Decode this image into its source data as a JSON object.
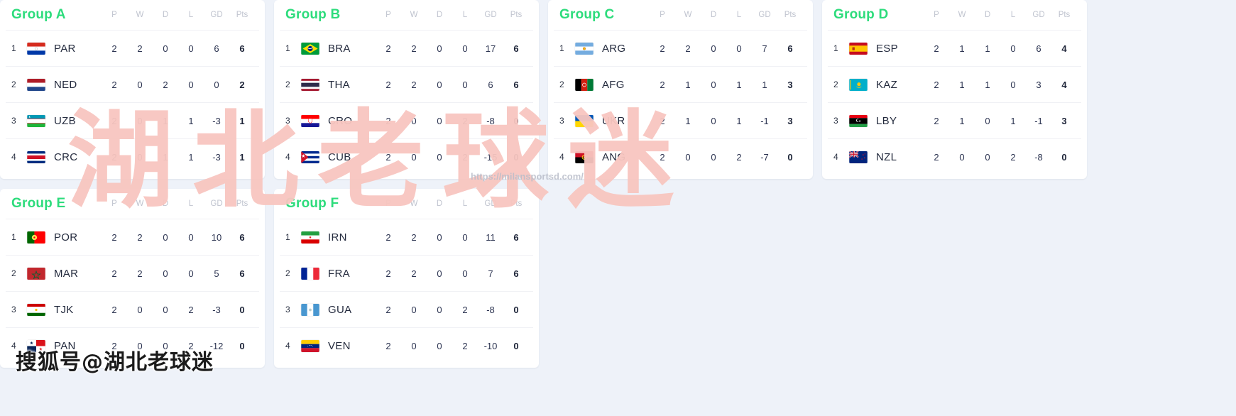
{
  "columns": [
    "P",
    "W",
    "D",
    "L",
    "GD",
    "Pts"
  ],
  "watermarks": {
    "big_text": "湖北老球迷",
    "url": "https://milansportsd.com/",
    "sohu": "搜狐号@湖北老球迷",
    "big_color": "#f8c6c0",
    "accent_color": "#2ddc7c"
  },
  "groups": [
    {
      "title": "Group A",
      "rows": [
        {
          "rank": "1",
          "team": "PAR",
          "flag": "paraguay",
          "P": "2",
          "W": "2",
          "D": "0",
          "L": "0",
          "GD": "6",
          "Pts": "6"
        },
        {
          "rank": "2",
          "team": "NED",
          "flag": "netherlands",
          "P": "2",
          "W": "0",
          "D": "2",
          "L": "0",
          "GD": "0",
          "Pts": "2"
        },
        {
          "rank": "3",
          "team": "UZB",
          "flag": "uzbekistan",
          "P": "2",
          "W": "0",
          "D": "1",
          "L": "1",
          "GD": "-3",
          "Pts": "1"
        },
        {
          "rank": "4",
          "team": "CRC",
          "flag": "costarica",
          "P": "2",
          "W": "0",
          "D": "1",
          "L": "1",
          "GD": "-3",
          "Pts": "1"
        }
      ]
    },
    {
      "title": "Group B",
      "rows": [
        {
          "rank": "1",
          "team": "BRA",
          "flag": "brazil",
          "P": "2",
          "W": "2",
          "D": "0",
          "L": "0",
          "GD": "17",
          "Pts": "6"
        },
        {
          "rank": "2",
          "team": "THA",
          "flag": "thailand",
          "P": "2",
          "W": "2",
          "D": "0",
          "L": "0",
          "GD": "6",
          "Pts": "6"
        },
        {
          "rank": "3",
          "team": "CRO",
          "flag": "croatia",
          "P": "2",
          "W": "0",
          "D": "0",
          "L": "2",
          "GD": "-8",
          "Pts": "0"
        },
        {
          "rank": "4",
          "team": "CUB",
          "flag": "cuba",
          "P": "2",
          "W": "0",
          "D": "0",
          "L": "2",
          "GD": "-15",
          "Pts": "0"
        }
      ]
    },
    {
      "title": "Group C",
      "rows": [
        {
          "rank": "1",
          "team": "ARG",
          "flag": "argentina",
          "P": "2",
          "W": "2",
          "D": "0",
          "L": "0",
          "GD": "7",
          "Pts": "6"
        },
        {
          "rank": "2",
          "team": "AFG",
          "flag": "afghanistan",
          "P": "2",
          "W": "1",
          "D": "0",
          "L": "1",
          "GD": "1",
          "Pts": "3"
        },
        {
          "rank": "3",
          "team": "UKR",
          "flag": "ukraine",
          "P": "2",
          "W": "1",
          "D": "0",
          "L": "1",
          "GD": "-1",
          "Pts": "3"
        },
        {
          "rank": "4",
          "team": "ANG",
          "flag": "angola",
          "P": "2",
          "W": "0",
          "D": "0",
          "L": "2",
          "GD": "-7",
          "Pts": "0"
        }
      ]
    },
    {
      "title": "Group D",
      "rows": [
        {
          "rank": "1",
          "team": "ESP",
          "flag": "spain",
          "P": "2",
          "W": "1",
          "D": "1",
          "L": "0",
          "GD": "6",
          "Pts": "4"
        },
        {
          "rank": "2",
          "team": "KAZ",
          "flag": "kazakhstan",
          "P": "2",
          "W": "1",
          "D": "1",
          "L": "0",
          "GD": "3",
          "Pts": "4"
        },
        {
          "rank": "3",
          "team": "LBY",
          "flag": "libya",
          "P": "2",
          "W": "1",
          "D": "0",
          "L": "1",
          "GD": "-1",
          "Pts": "3"
        },
        {
          "rank": "4",
          "team": "NZL",
          "flag": "newzealand",
          "P": "2",
          "W": "0",
          "D": "0",
          "L": "2",
          "GD": "-8",
          "Pts": "0"
        }
      ]
    },
    {
      "title": "Group E",
      "rows": [
        {
          "rank": "1",
          "team": "POR",
          "flag": "portugal",
          "P": "2",
          "W": "2",
          "D": "0",
          "L": "0",
          "GD": "10",
          "Pts": "6"
        },
        {
          "rank": "2",
          "team": "MAR",
          "flag": "morocco",
          "P": "2",
          "W": "2",
          "D": "0",
          "L": "0",
          "GD": "5",
          "Pts": "6"
        },
        {
          "rank": "3",
          "team": "TJK",
          "flag": "tajikistan",
          "P": "2",
          "W": "0",
          "D": "0",
          "L": "2",
          "GD": "-3",
          "Pts": "0"
        },
        {
          "rank": "4",
          "team": "PAN",
          "flag": "panama",
          "P": "2",
          "W": "0",
          "D": "0",
          "L": "2",
          "GD": "-12",
          "Pts": "0"
        }
      ]
    },
    {
      "title": "Group F",
      "rows": [
        {
          "rank": "1",
          "team": "IRN",
          "flag": "iran",
          "P": "2",
          "W": "2",
          "D": "0",
          "L": "0",
          "GD": "11",
          "Pts": "6"
        },
        {
          "rank": "2",
          "team": "FRA",
          "flag": "france",
          "P": "2",
          "W": "2",
          "D": "0",
          "L": "0",
          "GD": "7",
          "Pts": "6"
        },
        {
          "rank": "3",
          "team": "GUA",
          "flag": "guatemala",
          "P": "2",
          "W": "0",
          "D": "0",
          "L": "2",
          "GD": "-8",
          "Pts": "0"
        },
        {
          "rank": "4",
          "team": "VEN",
          "flag": "venezuela",
          "P": "2",
          "W": "0",
          "D": "0",
          "L": "2",
          "GD": "-10",
          "Pts": "0"
        }
      ]
    }
  ]
}
